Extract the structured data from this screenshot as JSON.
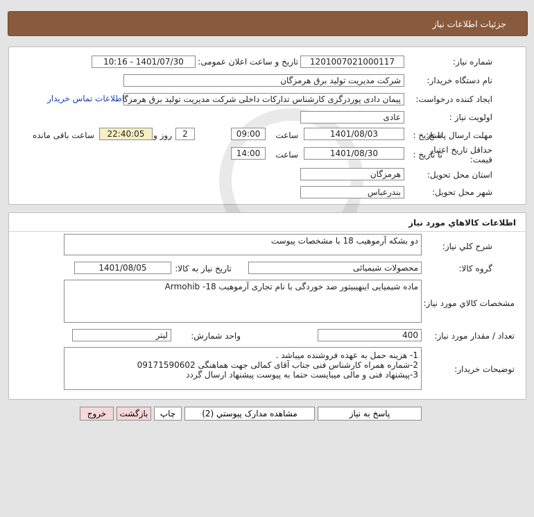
{
  "header": {
    "title": "جزئيات اطلاعات نياز"
  },
  "need_info": {
    "need_number_label": "شماره نیاز:",
    "need_number": "1201007021000117",
    "announce_label": "تاریخ و ساعت اعلان عمومی:",
    "announce_value": "1401/07/30 - 10:16",
    "buyer_org_label": "نام دستگاه خریدار:",
    "buyer_org": "شرکت مدیریت تولید برق هرمزگان",
    "requester_label": "ایجاد کننده درخواست:",
    "requester": "پیمان دادی پوردرگزی کارشناس تدارکات داخلی شرکت مدیریت تولید برق هرمزگان",
    "contact_link": "اطلاعات تماس خریدار",
    "priority_label": "اولویت نیاز :",
    "priority": "عادی",
    "deadline_label": "مهلت ارسال پاسخ:",
    "to_date_label": "تا تاریخ :",
    "deadline_date": "1401/08/03",
    "time_label": "ساعت",
    "deadline_time": "09:00",
    "days_value": "2",
    "days_label": "روز و",
    "remaining_time": "22:40:05",
    "remaining_label": "ساعت باقی مانده",
    "validity_label_1": "حداقل تاریخ اعتبار",
    "validity_label_2": "قیمت:",
    "validity_to_label": "تا تاریخ :",
    "validity_date": "1401/08/30",
    "validity_time_label": "ساعت",
    "validity_time": "14:00",
    "province_label": "استان محل تحویل:",
    "province": "هرمزگان",
    "city_label": "شهر محل تحویل:",
    "city": "بندرعباس"
  },
  "goods": {
    "section_title": "اطلاعات کالاهاي مورد نياز",
    "general_desc_label": "شرح کلي نياز:",
    "general_desc": "دو بشکه آرموهیب 18 با مشخصات پیوست",
    "group_label": "گروه کالا:",
    "group": "محصولات شیمیائی",
    "need_date_label": "تاريخ نياز به کالا:",
    "need_date": "1401/08/05",
    "specs_label": "مشخصات کالاي مورد نياز:",
    "specs": "ماده شیمیایی اینهیبیتور ضد خوردگی با نام تجاری آرموهیب 18- Armohib",
    "qty_label": "تعداد / مقدار مورد نياز:",
    "qty": "400",
    "unit_label": "واحد شمارش:",
    "unit": "لیتر",
    "buyer_notes_label": "توضيحات خريدار:",
    "buyer_notes": [
      "1- هزینه حمل به عهده فروشنده میباشد .",
      "2-شماره همراه کارشناس فنی جناب آقای کمالی جهت هماهنگی 09171590602",
      "3-پیشنهاد فنی و مالی میبایست حتما به  پیوست  پیشنهاد ارسال گردد"
    ]
  },
  "buttons": {
    "reply": "پاسخ به نياز",
    "attachments": "مشاهده مدارک پيوستي (2)",
    "print": "چاپ",
    "back": "بازگشت",
    "exit": "خروج"
  }
}
